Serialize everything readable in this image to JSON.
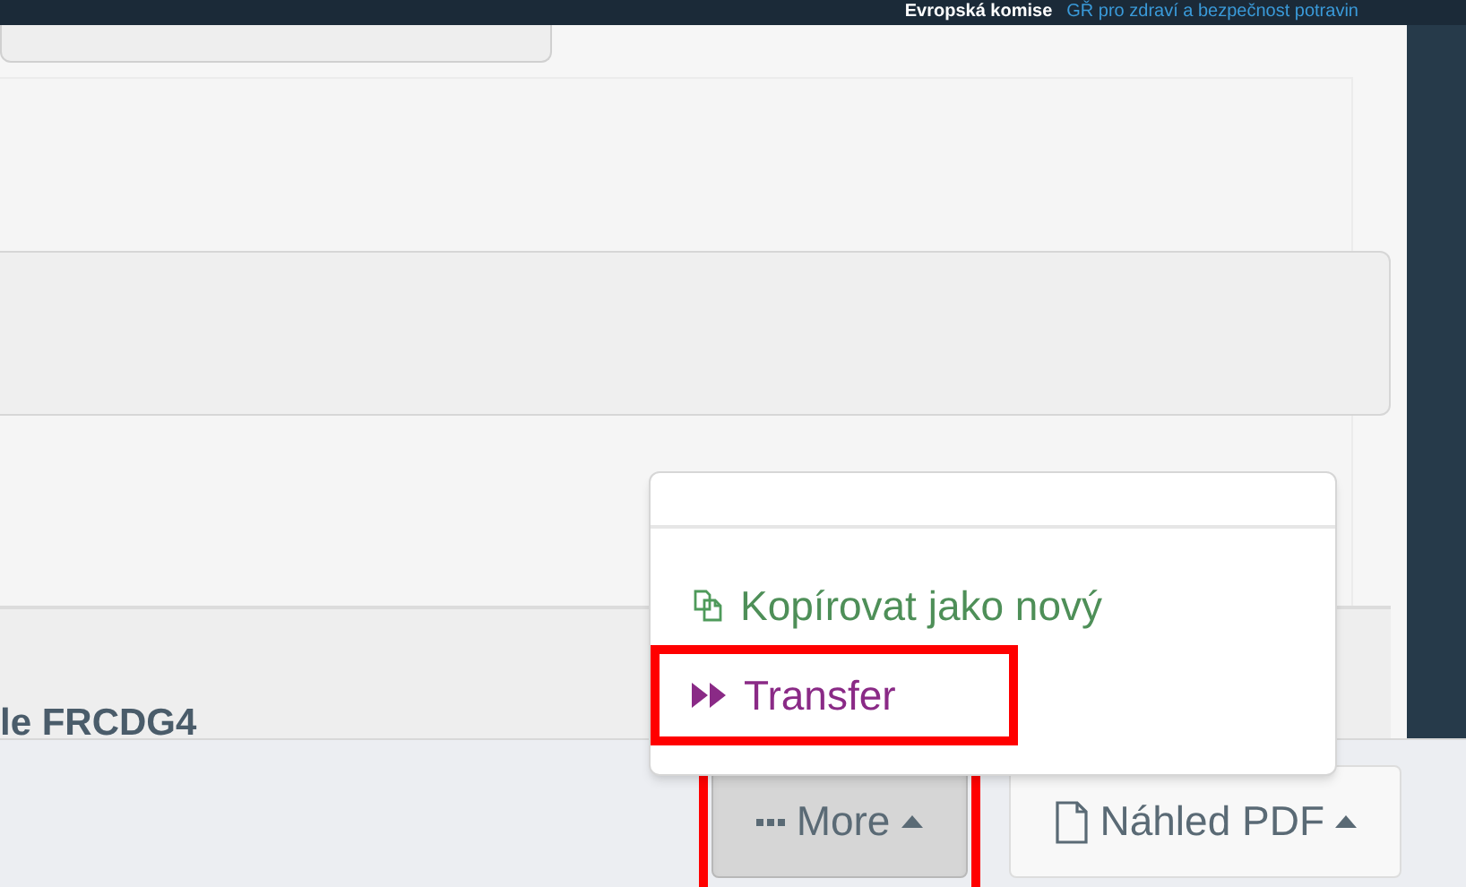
{
  "top_bar": {
    "organization": "Evropská komise",
    "department": "GŘ pro zdraví a bezpečnost potravin"
  },
  "section_heading": "le FRCDG4",
  "menu": {
    "items": [
      {
        "kind": "copy",
        "label": "Kopírovat jako nový",
        "highlighted": false
      },
      {
        "kind": "transfer",
        "label": "Transfer",
        "highlighted": true
      }
    ]
  },
  "footer_buttons": [
    {
      "kind": "more",
      "label": "More",
      "pressed": true,
      "highlighted": true
    },
    {
      "kind": "pdf",
      "label": "Náhled PDF",
      "pressed": false,
      "highlighted": false
    }
  ]
}
